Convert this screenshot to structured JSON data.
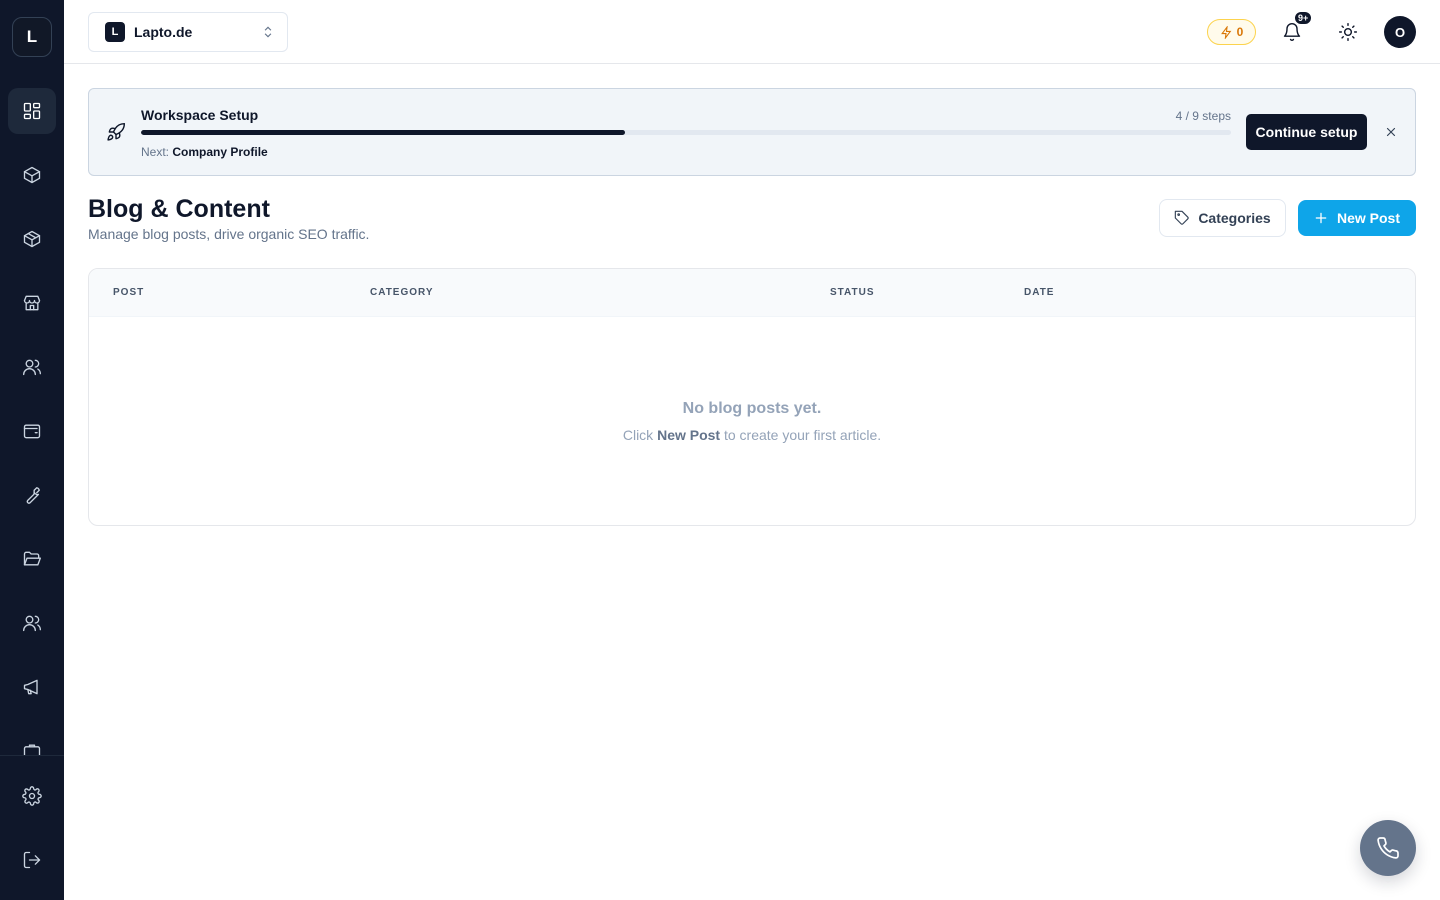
{
  "app": {
    "logo_letter": "L"
  },
  "sidebar": {
    "items": [
      {
        "name": "dashboard",
        "icon": "grid-icon"
      },
      {
        "name": "products",
        "icon": "box-icon"
      },
      {
        "name": "inventory",
        "icon": "package-icon"
      },
      {
        "name": "store",
        "icon": "store-icon"
      },
      {
        "name": "customers",
        "icon": "users-icon"
      },
      {
        "name": "wallet",
        "icon": "wallet-icon"
      },
      {
        "name": "tools",
        "icon": "wrench-icon"
      },
      {
        "name": "files",
        "icon": "folder-icon"
      },
      {
        "name": "team",
        "icon": "team-icon"
      },
      {
        "name": "marketing",
        "icon": "megaphone-icon"
      },
      {
        "name": "more",
        "icon": "briefcase-icon"
      }
    ],
    "bottom": [
      {
        "name": "settings",
        "icon": "gear-icon"
      },
      {
        "name": "logout",
        "icon": "logout-icon"
      }
    ]
  },
  "topbar": {
    "workspace_badge": "L",
    "workspace_name": "Lapto.de",
    "credits": "0",
    "notifications_badge": "9+",
    "avatar_letter": "O"
  },
  "setup": {
    "title": "Workspace Setup",
    "steps_text": "4 / 9 steps",
    "progress_fraction": 0.444,
    "next_label": "Next:",
    "next_value": "Company Profile",
    "continue_label": "Continue setup"
  },
  "page": {
    "title": "Blog & Content",
    "subtitle": "Manage blog posts, drive organic SEO traffic.",
    "categories_label": "Categories",
    "new_post_label": "New Post"
  },
  "table": {
    "columns": [
      "POST",
      "CATEGORY",
      "STATUS",
      "DATE"
    ],
    "empty_title": "No blog posts yet.",
    "empty_pre": "Click",
    "empty_bold": "New Post",
    "empty_post": "to create your first article."
  },
  "colors": {
    "sidebar_bg": "#0f172a",
    "accent": "#0ea5e9",
    "credits": "#d97706"
  }
}
